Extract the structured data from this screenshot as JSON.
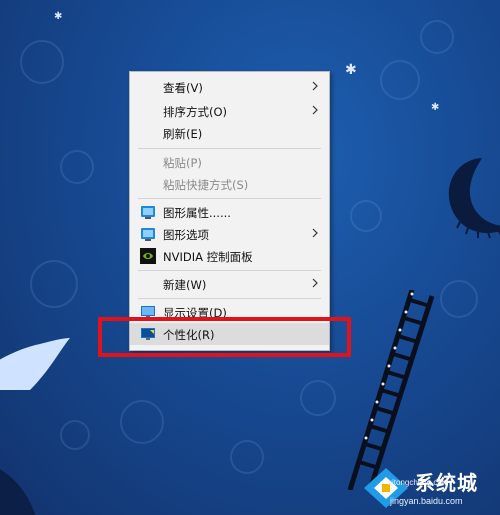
{
  "context_menu": {
    "items": [
      {
        "label": "查看(V)",
        "submenu": true,
        "enabled": true
      },
      {
        "label": "排序方式(O)",
        "submenu": true,
        "enabled": true
      },
      {
        "label": "刷新(E)",
        "submenu": false,
        "enabled": true
      },
      {
        "label": "粘贴(P)",
        "submenu": false,
        "enabled": false
      },
      {
        "label": "粘贴快捷方式(S)",
        "submenu": false,
        "enabled": false
      },
      {
        "label": "图形属性......",
        "submenu": false,
        "enabled": true,
        "icon": "intel-graphics-icon"
      },
      {
        "label": "图形选项",
        "submenu": true,
        "enabled": true,
        "icon": "intel-graphics-icon"
      },
      {
        "label": "NVIDIA 控制面板",
        "submenu": false,
        "enabled": true,
        "icon": "nvidia-icon"
      },
      {
        "label": "新建(W)",
        "submenu": true,
        "enabled": true
      },
      {
        "label": "显示设置(D)",
        "submenu": false,
        "enabled": true,
        "icon": "display-settings-icon"
      },
      {
        "label": "个性化(R)",
        "submenu": false,
        "enabled": true,
        "icon": "personalize-icon",
        "highlighted": true
      }
    ]
  },
  "annotation": {
    "color": "#e2121a"
  },
  "watermark": {
    "brand": "系统城",
    "url_top": "xitongcheng.com",
    "url_bottom": "jingyan.baidu.com"
  }
}
